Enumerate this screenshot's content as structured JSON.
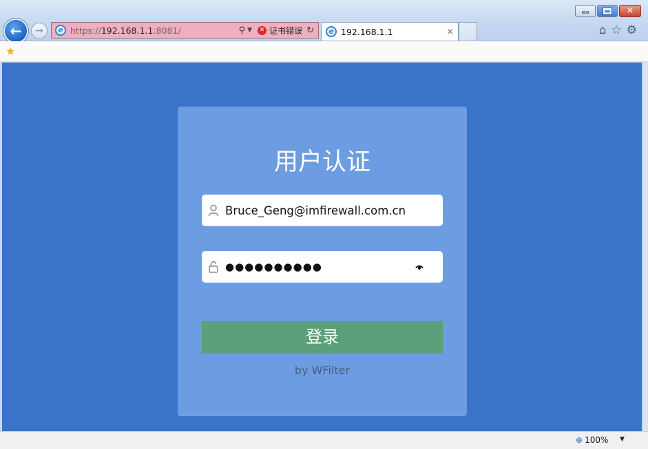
{
  "browser": {
    "address": {
      "scheme": "https://",
      "host": "192.168.1.1",
      "port_path": ":8081/"
    },
    "cert_error": "证书错误",
    "tab": {
      "title": "192.168.1.1",
      "close": "×"
    },
    "zoom": "100%",
    "colors": {
      "cert_error_bg": "#eeb0bd",
      "page_bg": "#3a74c9"
    }
  },
  "login": {
    "title": "用户认证",
    "username": "Bruce_Geng@imfirewall.com.cn",
    "password_mask": "●●●●●●●●●●",
    "submit_label": "登录",
    "byline": "by WFilter",
    "colors": {
      "card": "#6c9ce2",
      "button": "#5c9f7b"
    }
  }
}
